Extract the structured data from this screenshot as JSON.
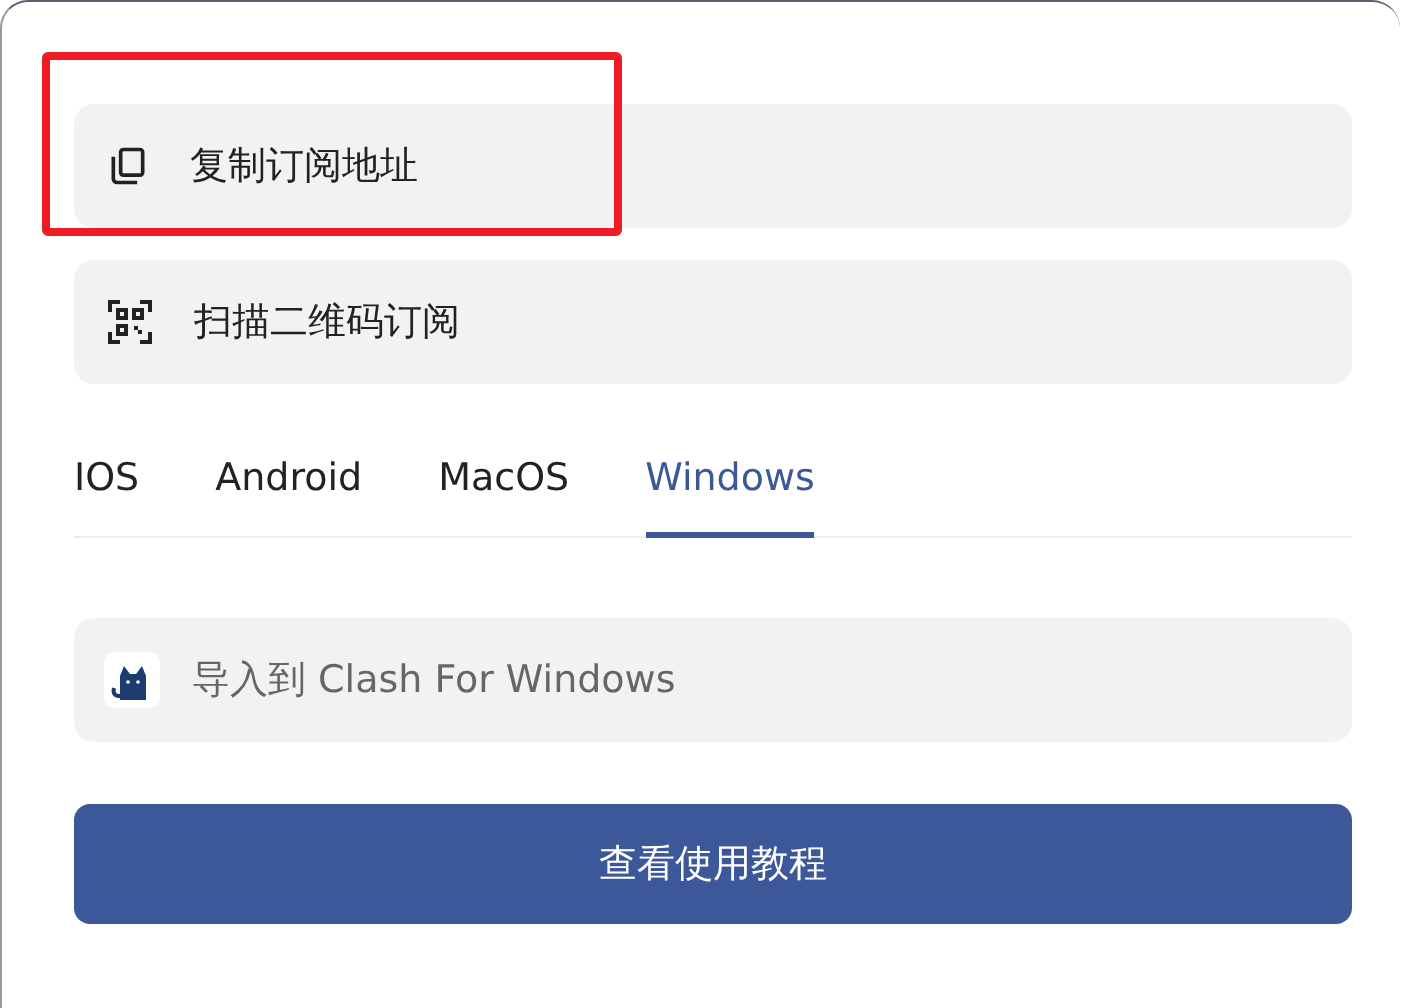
{
  "actions": [
    {
      "kind": "copy",
      "label": "复制订阅地址",
      "highlighted": true
    },
    {
      "kind": "qr",
      "label": "扫描二维码订阅",
      "highlighted": false
    }
  ],
  "tabs": [
    {
      "label": "IOS",
      "selected": false
    },
    {
      "label": "Android",
      "selected": false
    },
    {
      "label": "MacOS",
      "selected": false
    },
    {
      "label": "Windows",
      "selected": true
    }
  ],
  "import": {
    "label": "导入到 Clash For Windows"
  },
  "tutorial_button": "查看使用教程"
}
